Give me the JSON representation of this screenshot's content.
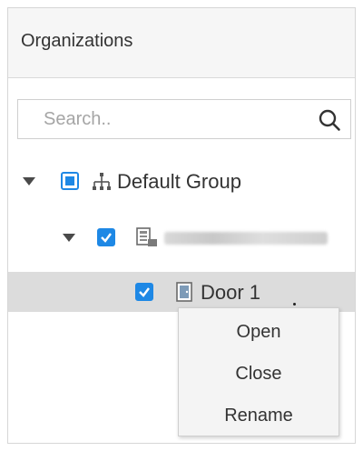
{
  "panel": {
    "title": "Organizations"
  },
  "search": {
    "placeholder": "Search.."
  },
  "tree": {
    "root": {
      "label": "Default Group",
      "checkbox": "partial",
      "expanded": true
    },
    "device": {
      "label": "",
      "checkbox": "checked",
      "expanded": true
    },
    "door": {
      "label": "Door 1",
      "checkbox": "checked",
      "selected": true
    }
  },
  "context_menu": {
    "items": [
      "Open",
      "Close",
      "Rename"
    ]
  },
  "colors": {
    "accent": "#1e88e5",
    "selected_row": "#dcdcdc",
    "header_bg": "#f6f6f6"
  }
}
